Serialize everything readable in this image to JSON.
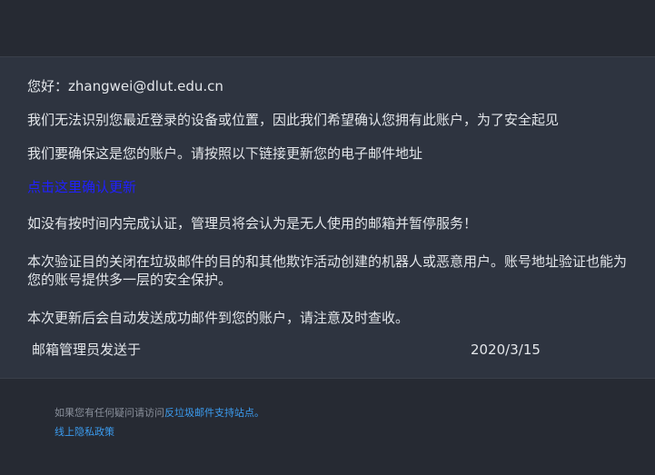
{
  "email": {
    "greeting": "您好：zhangwei@dlut.edu.cn",
    "line1": "我们无法识别您最近登录的设备或位置，因此我们希望确认您拥有此账户，为了安全起见",
    "line2": "我们要确保这是您的账户。请按照以下链接更新您的电子邮件地址",
    "confirm_link": "点击这里确认更新",
    "warning": "如没有按时间内完成认证，管理员将会认为是无人使用的邮箱并暂停服务！",
    "purpose": "本次验证目的关闭在垃圾邮件的目的和其他欺诈活动创建的机器人或恶意用户。账号地址验证也能为您的账号提供多一层的安全保护。",
    "notice": "本次更新后会自动发送成功邮件到您的账户，请注意及时查收。",
    "sender": "邮箱管理员发送于",
    "date": "2020/3/15"
  },
  "footer": {
    "question_prefix": "如果您有任何疑问请访问",
    "support_link": "反垃圾邮件支持站点。",
    "privacy_link": "线上隐私政策"
  },
  "colors": {
    "background": "#262a33",
    "content_background": "#2e3440",
    "text": "#e3e6ea",
    "link_blue": "#2020ff",
    "footer_link": "#3b9cf0"
  }
}
